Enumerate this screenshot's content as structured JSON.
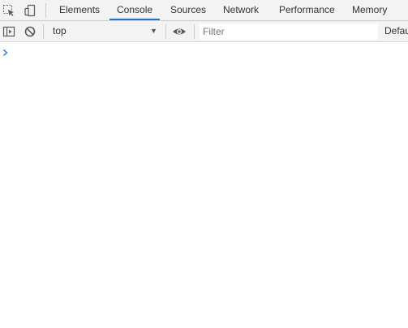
{
  "tabbar": {
    "tabs": [
      {
        "label": "Elements",
        "active": false
      },
      {
        "label": "Console",
        "active": true
      },
      {
        "label": "Sources",
        "active": false
      },
      {
        "label": "Network",
        "active": false
      },
      {
        "label": "Performance",
        "active": false
      },
      {
        "label": "Memory",
        "active": false
      }
    ],
    "icons": [
      "inspect-element-icon",
      "device-toolbar-icon"
    ]
  },
  "toolbar": {
    "context": "top",
    "filter_placeholder": "Filter",
    "levels_label": "Default levels",
    "icons": [
      "sidebar-toggle-icon",
      "clear-console-icon",
      "chevron-down-icon",
      "eye-icon"
    ]
  },
  "console": {
    "prompt_icon": "prompt-chevron-icon"
  },
  "colors": {
    "accent": "#1a73e8",
    "toolbar_bg": "#f3f3f3",
    "border": "#cccccc",
    "text": "#333333",
    "prompt": "#367cf1"
  }
}
